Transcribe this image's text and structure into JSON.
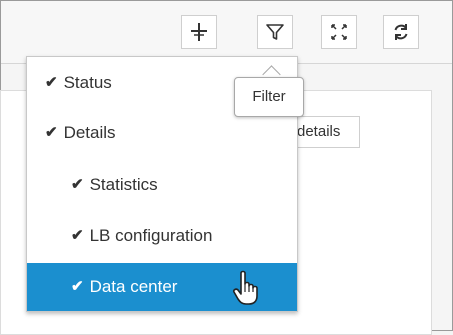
{
  "toolbar": {
    "buttons": [
      {
        "name": "add-icon",
        "icon": "plus-cross"
      },
      {
        "name": "filter-icon",
        "icon": "funnel"
      },
      {
        "name": "fullscreen-icon",
        "icon": "expand-arrows"
      },
      {
        "name": "refresh-icon",
        "icon": "circular-arrows"
      }
    ]
  },
  "tooltip": {
    "text": "Filter"
  },
  "panel": {
    "details_button": "details"
  },
  "menu": {
    "items": [
      {
        "label": "Status",
        "checked": true,
        "level": 0,
        "selected": false
      },
      {
        "label": "Details",
        "checked": true,
        "level": 0,
        "selected": false
      },
      {
        "label": "Statistics",
        "checked": true,
        "level": 1,
        "selected": false
      },
      {
        "label": "LB configuration",
        "checked": true,
        "level": 1,
        "selected": false
      },
      {
        "label": "Data center",
        "checked": true,
        "level": 1,
        "selected": true
      }
    ],
    "check_glyph": "✔"
  },
  "colors": {
    "selected_bg": "#1b8fcf",
    "selected_text": "#ffffff"
  }
}
